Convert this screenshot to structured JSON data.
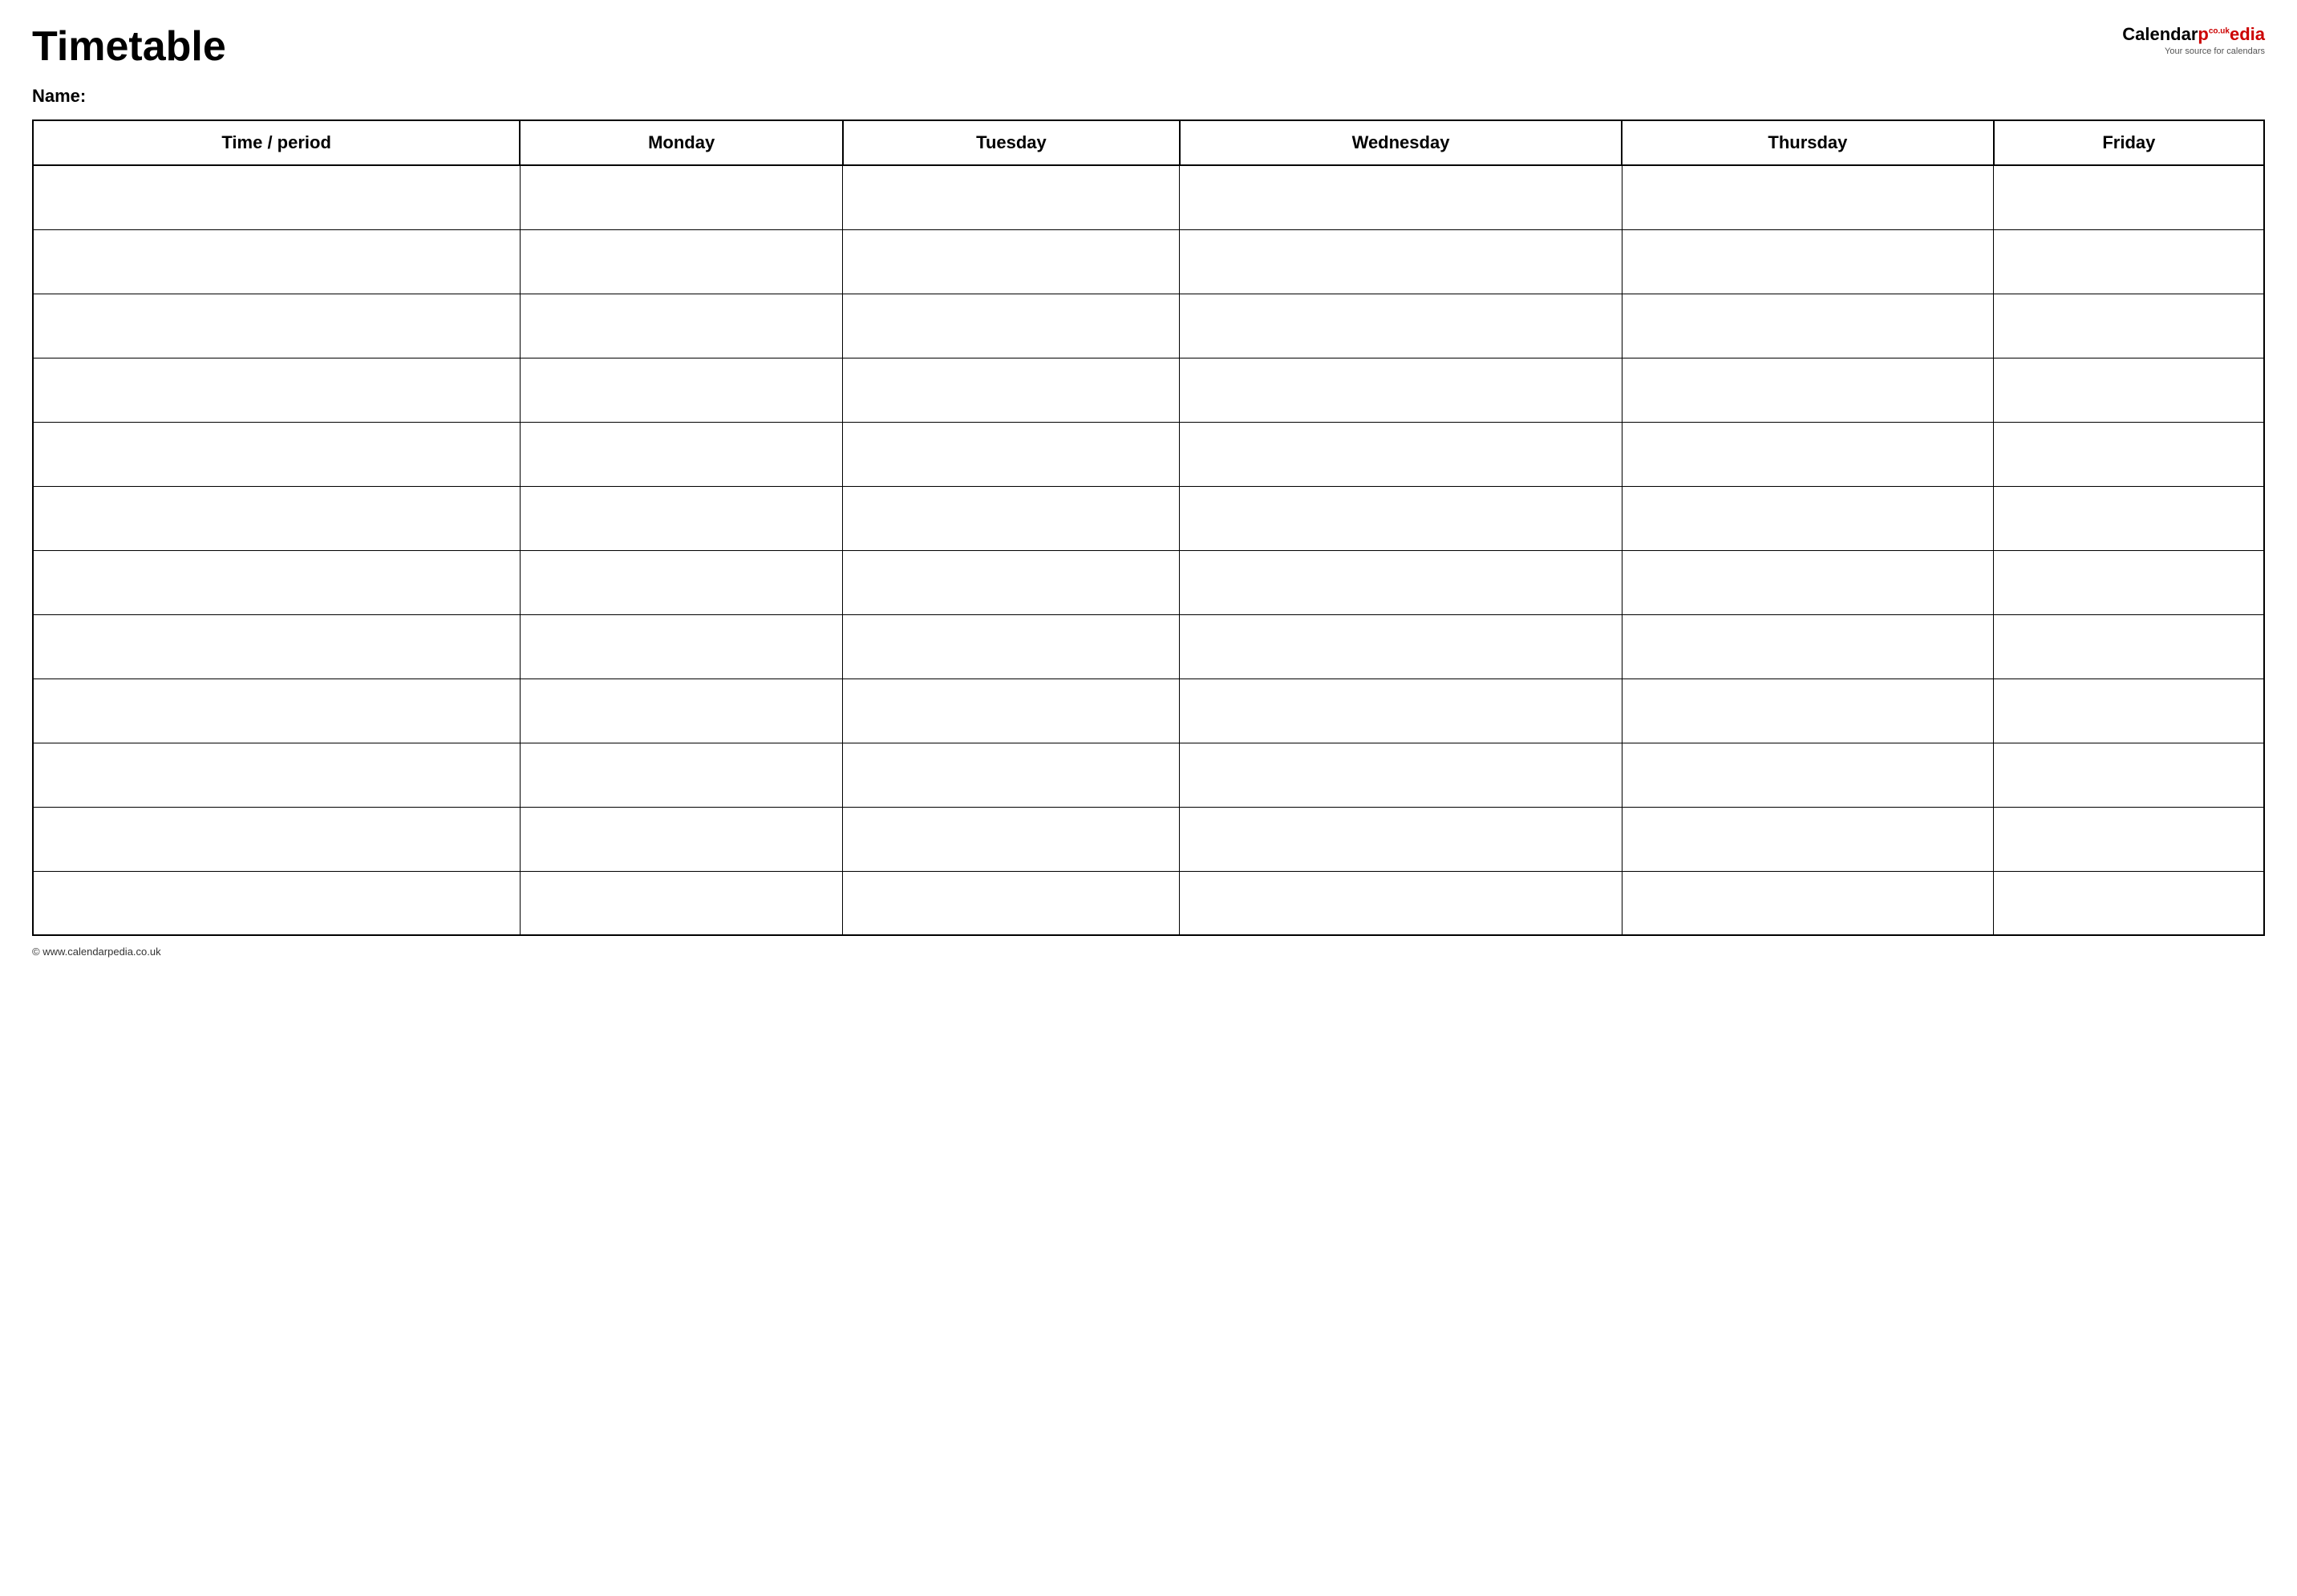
{
  "header": {
    "title": "Timetable",
    "logo": {
      "calendar_text": "Calendar",
      "pedia_text": "pedia",
      "co_text": "co.uk",
      "subtitle": "Your source for calendars"
    }
  },
  "name_label": "Name:",
  "table": {
    "columns": [
      "Time / period",
      "Monday",
      "Tuesday",
      "Wednesday",
      "Thursday",
      "Friday"
    ],
    "row_count": 12
  },
  "footer": {
    "url": "© www.calendarpedia.co.uk"
  }
}
